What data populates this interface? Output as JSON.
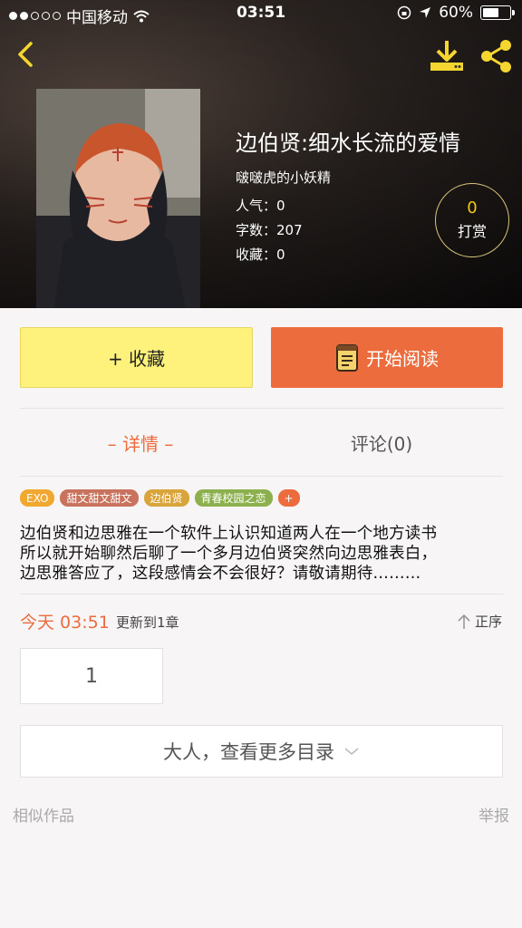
{
  "status_bar": {
    "carrier": "中国移动",
    "time": "03:51",
    "battery": "60%"
  },
  "book": {
    "title": "边伯贤:细水长流的爱情",
    "author": "啵啵虎的小妖精",
    "stats": [
      {
        "label": "人气：",
        "value": "0"
      },
      {
        "label": "字数：",
        "value": "207"
      },
      {
        "label": "收藏：",
        "value": "0"
      }
    ]
  },
  "tip": {
    "count": "0",
    "label": "打赏"
  },
  "actions": {
    "favorite_label": "+ 收藏",
    "read_label": "开始阅读"
  },
  "tabs": {
    "detail": "– 详情 –",
    "comment": "评论(0)"
  },
  "tags": [
    {
      "label": "EXO",
      "color": "#f0a830"
    },
    {
      "label": "甜文甜文甜文",
      "color": "#c9735f"
    },
    {
      "label": "边伯贤",
      "color": "#d9a43a"
    },
    {
      "label": "青春校园之恋",
      "color": "#8bb04d"
    },
    {
      "label": "+",
      "color": "#ec6c3e"
    }
  ],
  "description_lines": [
    "边伯贤和边思雅在一个软件上认识知道两人在一个地方读书",
    "所以就开始聊然后聊了一个多月边伯贤突然向边思雅表白，",
    "边思雅答应了，这段感情会不会很好？请敬请期待………"
  ],
  "update": {
    "time": "今天 03:51",
    "text": "更新到1章",
    "order_label": "正序"
  },
  "chapter": {
    "number": "1"
  },
  "more_catalog": "大人，查看更多目录",
  "footer": {
    "similar": "相似作品",
    "report": "举报"
  },
  "colors": {
    "accent": "#ec6c3e",
    "favorite_bg": "#fff27c",
    "icon_yellow": "#f5d630"
  }
}
